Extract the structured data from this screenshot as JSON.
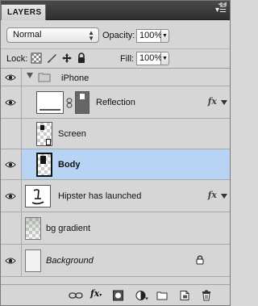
{
  "panel": {
    "title": "LAYERS"
  },
  "blend": {
    "mode": "Normal",
    "opacity_label": "Opacity:",
    "opacity_value": "100%"
  },
  "lock": {
    "label": "Lock:",
    "fill_label": "Fill:",
    "fill_value": "100%"
  },
  "layers": [
    {
      "name": "iPhone",
      "type": "group"
    },
    {
      "name": "Reflection",
      "type": "layer",
      "fx": "fx"
    },
    {
      "name": "Screen",
      "type": "layer"
    },
    {
      "name": "Body",
      "type": "layer",
      "selected": true
    },
    {
      "name": "Hipster has launched",
      "type": "layer",
      "fx": "fx"
    },
    {
      "name": "bg gradient",
      "type": "layer"
    },
    {
      "name": "Background",
      "type": "background"
    }
  ],
  "colors": {
    "selection": "#b8d4f5",
    "panel_bg": "#d6d6d6",
    "titlebar": "#3a3a3a"
  }
}
